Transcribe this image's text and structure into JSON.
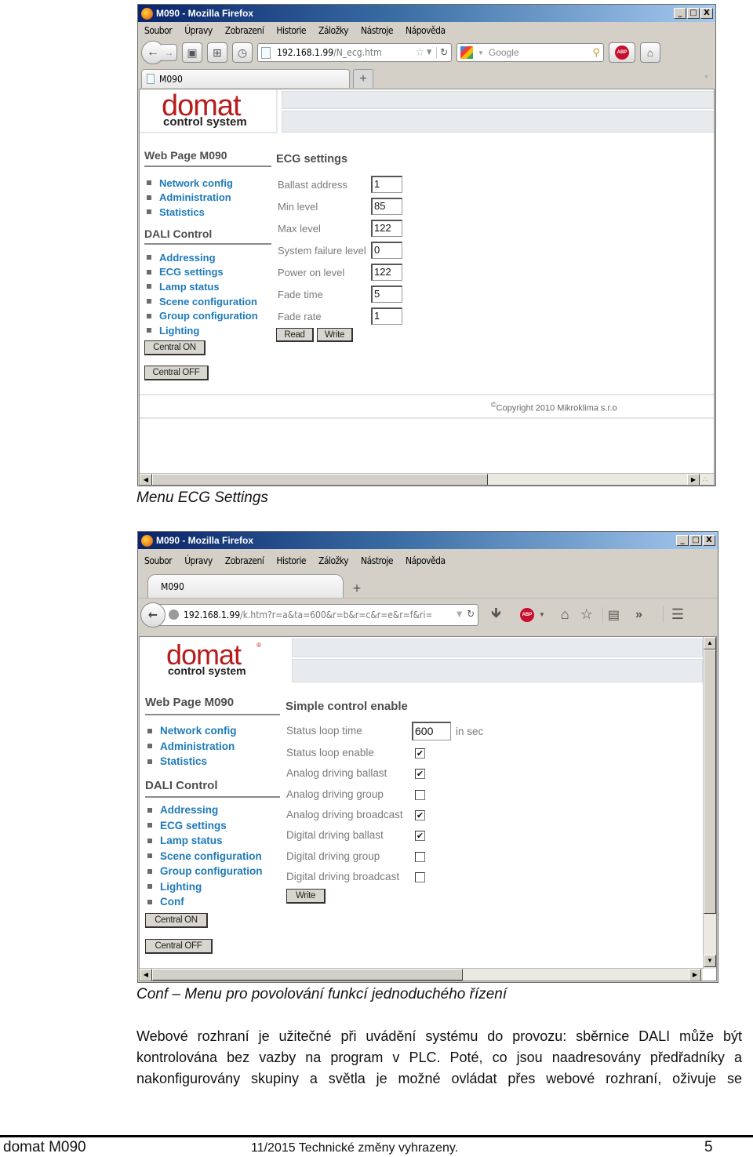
{
  "screenshot1": {
    "window_title": "M090 - Mozilla Firefox",
    "window_controls": [
      "_",
      "□",
      "X"
    ],
    "menu": [
      "Soubor",
      "Úpravy",
      "Zobrazení",
      "Historie",
      "Záložky",
      "Nástroje",
      "Nápověda"
    ],
    "url_host": "192.168.1.99",
    "url_path": "/N_ecg.htm",
    "search_placeholder": "Google",
    "tab_label": "M090",
    "new_tab_label": "+",
    "logo": {
      "word": "domat",
      "sub": "control system"
    },
    "sidebar": {
      "heading1": "Web Page M090",
      "items1": [
        "Network config",
        "Administration",
        "Statistics"
      ],
      "heading2": "DALI Control",
      "items2": [
        "Addressing",
        "ECG settings",
        "Lamp status",
        "Scene configuration",
        "Group configuration",
        "Lighting"
      ],
      "central_on": "Central ON",
      "central_off": "Central OFF"
    },
    "content": {
      "heading": "ECG settings",
      "fields": [
        {
          "label": "Ballast address",
          "value": "1"
        },
        {
          "label": "Min level",
          "value": "85"
        },
        {
          "label": "Max level",
          "value": "122"
        },
        {
          "label": "System failure level",
          "value": "0"
        },
        {
          "label": "Power on level",
          "value": "122"
        },
        {
          "label": "Fade time",
          "value": "5"
        },
        {
          "label": "Fade rate",
          "value": "1"
        }
      ],
      "read_label": "Read",
      "write_label": "Write"
    },
    "copyright_symbol": "©",
    "copyright": "Copyright 2010 Mikroklima s.r.o"
  },
  "caption1": "Menu ECG Settings",
  "screenshot2": {
    "window_title": "M090 - Mozilla Firefox",
    "window_controls": [
      "_",
      "□",
      "X"
    ],
    "menu": [
      "Soubor",
      "Úpravy",
      "Zobrazení",
      "Historie",
      "Záložky",
      "Nástroje",
      "Nápověda"
    ],
    "tab_label": "M090",
    "new_tab_label": "+",
    "url_host": "192.168.1.99",
    "url_path": "/k.htm?r=a&ta=600&r=b&r=c&r=e&r=f&ri=",
    "overflow_label": "»",
    "logo": {
      "word": "domat",
      "sub": "control system",
      "reg": "®"
    },
    "sidebar": {
      "heading1": "Web Page M090",
      "items1": [
        "Network config",
        "Administration",
        "Statistics"
      ],
      "heading2": "DALI Control",
      "items2": [
        "Addressing",
        "ECG settings",
        "Lamp status",
        "Scene configuration",
        "Group configuration",
        "Lighting",
        "Conf"
      ],
      "central_on": "Central ON",
      "central_off": "Central OFF"
    },
    "content": {
      "heading": "Simple control enable",
      "status_loop_time_label": "Status loop time",
      "status_loop_time_value": "600",
      "status_loop_time_unit": "in sec",
      "checkboxes": [
        {
          "label": "Status loop enable",
          "checked": true
        },
        {
          "label": "Analog driving ballast",
          "checked": true
        },
        {
          "label": "Analog driving group",
          "checked": false
        },
        {
          "label": "Analog driving broadcast",
          "checked": true
        },
        {
          "label": "Digital driving ballast",
          "checked": true
        },
        {
          "label": "Digital driving group",
          "checked": false
        },
        {
          "label": "Digital driving broadcast",
          "checked": false
        }
      ],
      "write_label": "Write"
    }
  },
  "caption2": "Conf – Menu pro povolování funkcí jednoduchého řízení",
  "paragraph_lines": [
    "Webové rozhraní je užitečné při uvádění systému do provozu: sběrnice DALI může být",
    "kontrolována bez vazby na program v PLC. Poté, co jsou naadresovány předřadníky a",
    "nakonfigurovány skupiny a světla je možné ovládat přes webové rozhraní, oživuje se"
  ],
  "page_footer": {
    "left": "domat M090",
    "center": "11/2015 Technické změny vyhrazeny.",
    "page_number": "5"
  }
}
